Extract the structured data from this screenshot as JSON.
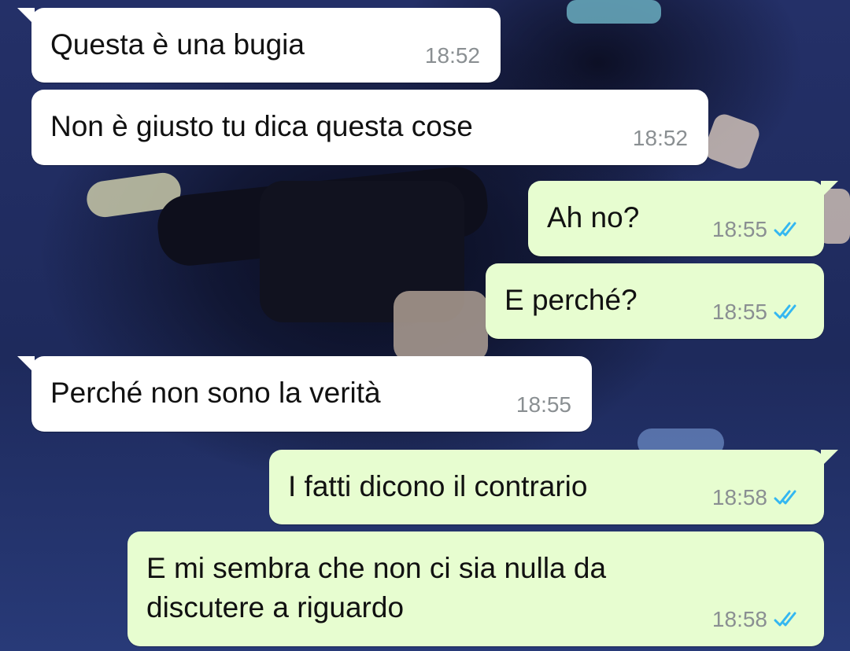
{
  "messages": [
    {
      "direction": "in",
      "text": "Questa è una bugia",
      "time": "18:52"
    },
    {
      "direction": "in",
      "text": "Non è giusto tu dica questa cose",
      "time": "18:52"
    },
    {
      "direction": "out",
      "text": "Ah no?",
      "time": "18:55",
      "status": "read-ticks-icon"
    },
    {
      "direction": "out",
      "text": "E perché?",
      "time": "18:55",
      "status": "read-ticks-icon"
    },
    {
      "direction": "in",
      "text": "Perché non sono la verità",
      "time": "18:55"
    },
    {
      "direction": "out",
      "text": "I fatti dicono il contrario",
      "time": "18:58",
      "status": "read-ticks-icon"
    },
    {
      "direction": "out",
      "text": "E mi sembra che non ci sia nulla da discutere a riguardo",
      "time": "18:58",
      "status": "read-ticks-icon"
    }
  ],
  "colors": {
    "incoming_bubble": "#ffffff",
    "outgoing_bubble": "#e7fdd0",
    "timestamp": "#8a8f92",
    "read_ticks": "#34b7f1",
    "wallpaper": "#1f2a5a"
  }
}
